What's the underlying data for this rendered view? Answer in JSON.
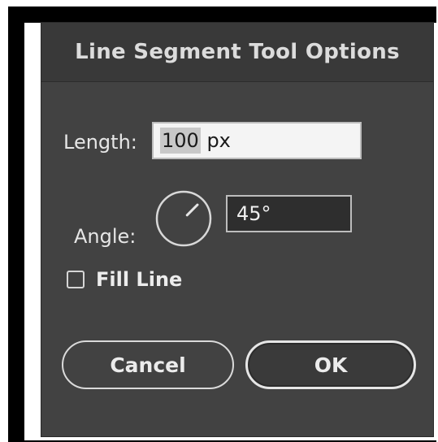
{
  "dialog": {
    "title": "Line Segment Tool Options",
    "length": {
      "label": "Length:",
      "value": "100 px",
      "value_selected": "100",
      "value_rest": " px"
    },
    "angle": {
      "label": "Angle:",
      "value": "45°",
      "degrees": 45
    },
    "fill_line": {
      "label": "Fill Line",
      "checked": false
    },
    "buttons": {
      "cancel": "Cancel",
      "ok": "OK"
    }
  },
  "colors": {
    "dialog_bg": "#424242",
    "titlebar_bg": "#393939",
    "text": "#e6e6e6",
    "field_bg": "#f4f4f4",
    "dark_field_bg": "#2e2e2e"
  }
}
